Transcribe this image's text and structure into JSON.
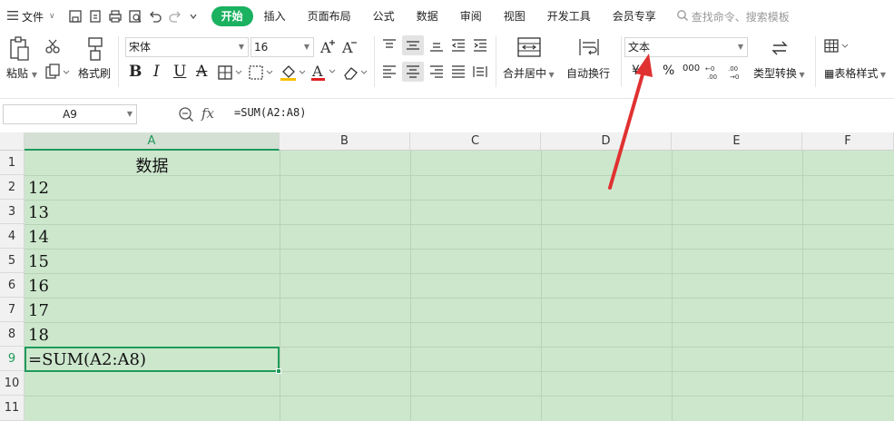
{
  "menubar": {
    "file_label": "文件",
    "tabs": [
      "开始",
      "插入",
      "页面布局",
      "公式",
      "数据",
      "审阅",
      "视图",
      "开发工具",
      "会员专享"
    ],
    "search_placeholder": "查找命令、搜索模板"
  },
  "ribbon": {
    "paste_label": "粘贴",
    "format_painter_label": "格式刷",
    "font_name": "宋体",
    "font_size": "16",
    "merge_center_label": "合并居中",
    "wrap_text_label": "自动换行",
    "number_format": "文本",
    "convert_type_label": "类型转换",
    "table_style_label": "表格样式",
    "currency_symbol": "¥",
    "percent_symbol": "%",
    "thousands_symbol": "000"
  },
  "formula_bar": {
    "name_box": "A9",
    "fx_label": "fx",
    "formula": "=SUM(A2:A8)"
  },
  "sheet": {
    "columns": [
      "A",
      "B",
      "C",
      "D",
      "E",
      "F"
    ],
    "rows": [
      "1",
      "2",
      "3",
      "4",
      "5",
      "6",
      "7",
      "8",
      "9",
      "10",
      "11"
    ],
    "cells": {
      "A1": "数据",
      "A2": "12",
      "A3": "13",
      "A4": "14",
      "A5": "15",
      "A6": "16",
      "A7": "17",
      "A8": "18",
      "A9": "=SUM(A2:A8)"
    },
    "active_cell": "A9"
  },
  "colors": {
    "accent": "#1ab160",
    "grid_fill": "#cde7cd",
    "annotation_arrow": "#e03131"
  }
}
